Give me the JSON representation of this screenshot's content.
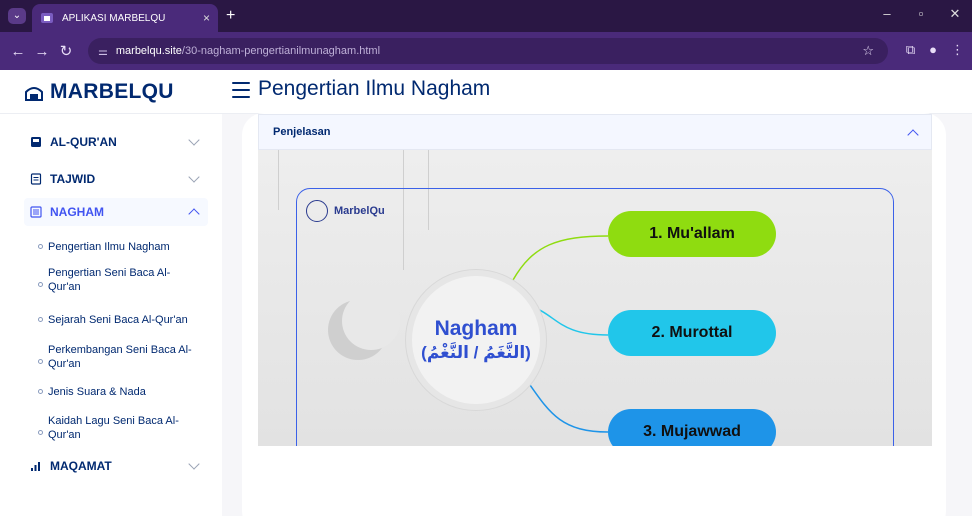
{
  "browser": {
    "tab_title": "APLIKASI MARBELQU",
    "tab_close": "×",
    "new_tab": "+",
    "url_host": "marbelqu.site",
    "url_path": "/30-nagham-pengertianilmunagham.html"
  },
  "header": {
    "brand": "MARBELQU"
  },
  "sidebar": {
    "items": [
      {
        "label": "AL-QUR'AN",
        "icon": "book-icon"
      },
      {
        "label": "TAJWID",
        "icon": "document-icon"
      },
      {
        "label": "NAGHAM",
        "icon": "list-icon"
      },
      {
        "label": "MAQAMAT",
        "icon": "bar-chart-icon"
      }
    ],
    "nagham_sub": [
      "Pengertian Ilmu Nagham",
      "Pengertian Seni Baca Al-Qur'an",
      "Sejarah Seni Baca Al-Qur'an",
      "Perkembangan Seni Baca Al-Qur'an",
      "Jenis Suara & Nada",
      "Kaidah Lagu Seni Baca Al-Qur'an"
    ]
  },
  "main": {
    "title": "Pengertian Ilmu Nagham",
    "accordion_label": "Penjelasan"
  },
  "infographic": {
    "logo_text": "MarbelQu",
    "center_title": "Nagham",
    "center_arabic": "(النَّغَمُ / النَّغْمُ)",
    "branches": [
      "1. Mu'allam",
      "2. Murottal",
      "3. Mujawwad"
    ]
  },
  "colors": {
    "accent": "#4154f1",
    "brand": "#012970",
    "branch1": "#8fdc10",
    "branch2": "#21c6ea",
    "branch3": "#1e94e8"
  }
}
